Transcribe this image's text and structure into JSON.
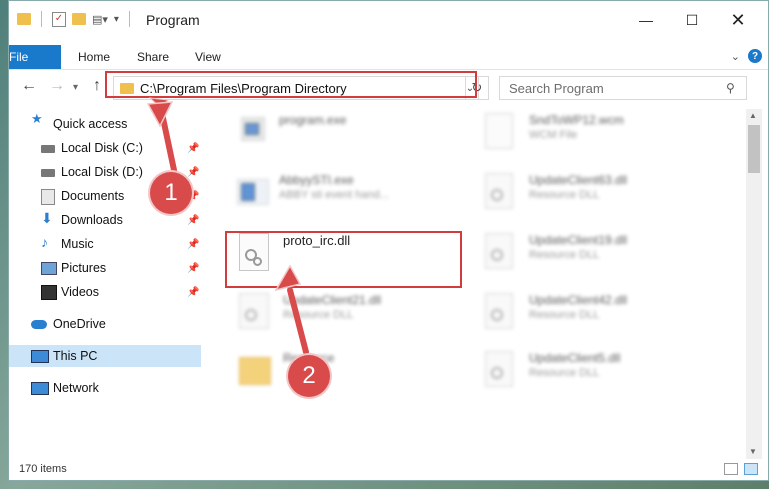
{
  "window": {
    "title": "Program",
    "quick_access_toolbar": [
      "folder-icon",
      "properties-check-icon",
      "new-folder-icon",
      "customize-icon"
    ]
  },
  "ribbon": {
    "tabs": [
      "File",
      "Home",
      "Share",
      "View"
    ]
  },
  "address_bar": {
    "path": "C:\\Program Files\\Program Directory"
  },
  "search": {
    "placeholder": "Search Program"
  },
  "sidebar": {
    "items": [
      {
        "label": "Quick access",
        "icon": "star-icon",
        "pinned": false
      },
      {
        "label": "Local Disk (C:)",
        "icon": "drive-icon",
        "pinned": true
      },
      {
        "label": "Local Disk (D:)",
        "icon": "drive-icon",
        "pinned": true
      },
      {
        "label": "Documents",
        "icon": "documents-icon",
        "pinned": true
      },
      {
        "label": "Downloads",
        "icon": "download-icon",
        "pinned": true
      },
      {
        "label": "Music",
        "icon": "music-icon",
        "pinned": true
      },
      {
        "label": "Pictures",
        "icon": "pictures-icon",
        "pinned": true
      },
      {
        "label": "Videos",
        "icon": "video-icon",
        "pinned": true
      },
      {
        "label": "OneDrive",
        "icon": "cloud-icon",
        "pinned": false
      },
      {
        "label": "This PC",
        "icon": "computer-icon",
        "pinned": false,
        "selected": true
      },
      {
        "label": "Network",
        "icon": "network-icon",
        "pinned": false
      }
    ]
  },
  "files": {
    "left": [
      {
        "name": "program.exe",
        "type": ""
      },
      {
        "name": "AbbyySTI.exe",
        "type": "ABBY sti event hand..."
      },
      {
        "name": "proto_irc.dll",
        "type": "",
        "highlighted": true
      },
      {
        "name": "UpdateClient21.dll",
        "type": "Resource DLL"
      },
      {
        "name": "Resource",
        "type": ""
      }
    ],
    "right": [
      {
        "name": "SndToWP12.wcm",
        "type": "WCM File"
      },
      {
        "name": "UpdateClient63.dll",
        "type": "Resource DLL"
      },
      {
        "name": "UpdateClient19.dll",
        "type": "Resource DLL"
      },
      {
        "name": "UpdateClient42.dll",
        "type": "Resource DLL"
      },
      {
        "name": "UpdateClient5.dll",
        "type": "Resource DLL"
      }
    ]
  },
  "status_bar": {
    "item_count": "170 items"
  },
  "annotations": {
    "step1": "1",
    "step2": "2",
    "accent_color": "#d94b4b"
  }
}
